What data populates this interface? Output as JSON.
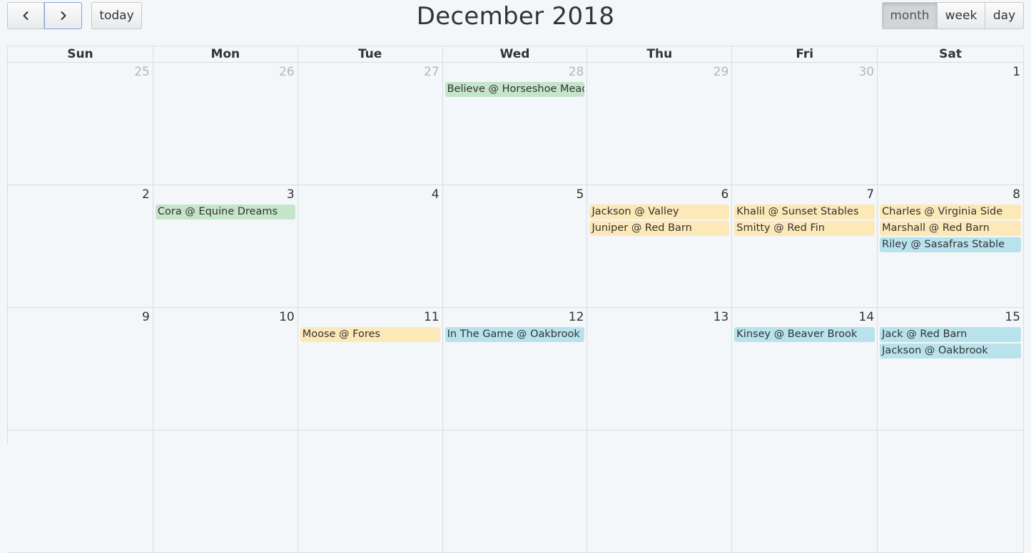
{
  "toolbar": {
    "today_label": "today",
    "title": "December 2018",
    "views": [
      "month",
      "week",
      "day"
    ],
    "active_view": "month"
  },
  "weekdays": [
    "Sun",
    "Mon",
    "Tue",
    "Wed",
    "Thu",
    "Fri",
    "Sat"
  ],
  "colors": {
    "green": "#c4e5c9",
    "yellow": "#fde9b8",
    "blue": "#b8e3ec"
  },
  "weeks": [
    [
      {
        "num": "25",
        "other": true,
        "events": []
      },
      {
        "num": "26",
        "other": true,
        "events": []
      },
      {
        "num": "27",
        "other": true,
        "events": []
      },
      {
        "num": "28",
        "other": true,
        "events": [
          {
            "title": "Believe @ Horseshoe Mead",
            "color": "green"
          }
        ]
      },
      {
        "num": "29",
        "other": true,
        "events": []
      },
      {
        "num": "30",
        "other": true,
        "events": []
      },
      {
        "num": "1",
        "other": false,
        "events": []
      }
    ],
    [
      {
        "num": "2",
        "other": false,
        "events": []
      },
      {
        "num": "3",
        "other": false,
        "events": [
          {
            "title": "Cora @ Equine Dreams",
            "color": "green"
          }
        ]
      },
      {
        "num": "4",
        "other": false,
        "events": []
      },
      {
        "num": "5",
        "other": false,
        "events": []
      },
      {
        "num": "6",
        "other": false,
        "events": [
          {
            "title": "Jackson @ Valley",
            "color": "yellow"
          },
          {
            "title": "Juniper @ Red Barn",
            "color": "yellow"
          }
        ]
      },
      {
        "num": "7",
        "other": false,
        "events": [
          {
            "title": "Khalil @ Sunset Stables",
            "color": "yellow"
          },
          {
            "title": "Smitty @ Red Fin",
            "color": "yellow"
          }
        ]
      },
      {
        "num": "8",
        "other": false,
        "events": [
          {
            "title": "Charles @ Virginia Side",
            "color": "yellow"
          },
          {
            "title": "Marshall @ Red Barn",
            "color": "yellow"
          },
          {
            "title": "Riley @ Sasafras Stable",
            "color": "blue"
          }
        ]
      }
    ],
    [
      {
        "num": "9",
        "other": false,
        "events": []
      },
      {
        "num": "10",
        "other": false,
        "events": []
      },
      {
        "num": "11",
        "other": false,
        "events": [
          {
            "title": "Moose @ Fores",
            "color": "yellow"
          }
        ]
      },
      {
        "num": "12",
        "other": false,
        "events": [
          {
            "title": "In The Game @ Oakbrook",
            "color": "blue"
          }
        ]
      },
      {
        "num": "13",
        "other": false,
        "events": []
      },
      {
        "num": "14",
        "other": false,
        "events": [
          {
            "title": "Kinsey @ Beaver Brook",
            "color": "blue"
          }
        ]
      },
      {
        "num": "15",
        "other": false,
        "events": [
          {
            "title": "Jack @ Red Barn",
            "color": "blue"
          },
          {
            "title": "Jackson @ Oakbrook",
            "color": "blue"
          }
        ]
      }
    ],
    [
      {
        "num": "",
        "other": false,
        "events": []
      },
      {
        "num": "",
        "other": false,
        "events": []
      },
      {
        "num": "",
        "other": false,
        "events": []
      },
      {
        "num": "",
        "other": false,
        "events": []
      },
      {
        "num": "",
        "other": false,
        "events": []
      },
      {
        "num": "",
        "other": false,
        "events": []
      },
      {
        "num": "",
        "other": false,
        "events": []
      }
    ]
  ]
}
